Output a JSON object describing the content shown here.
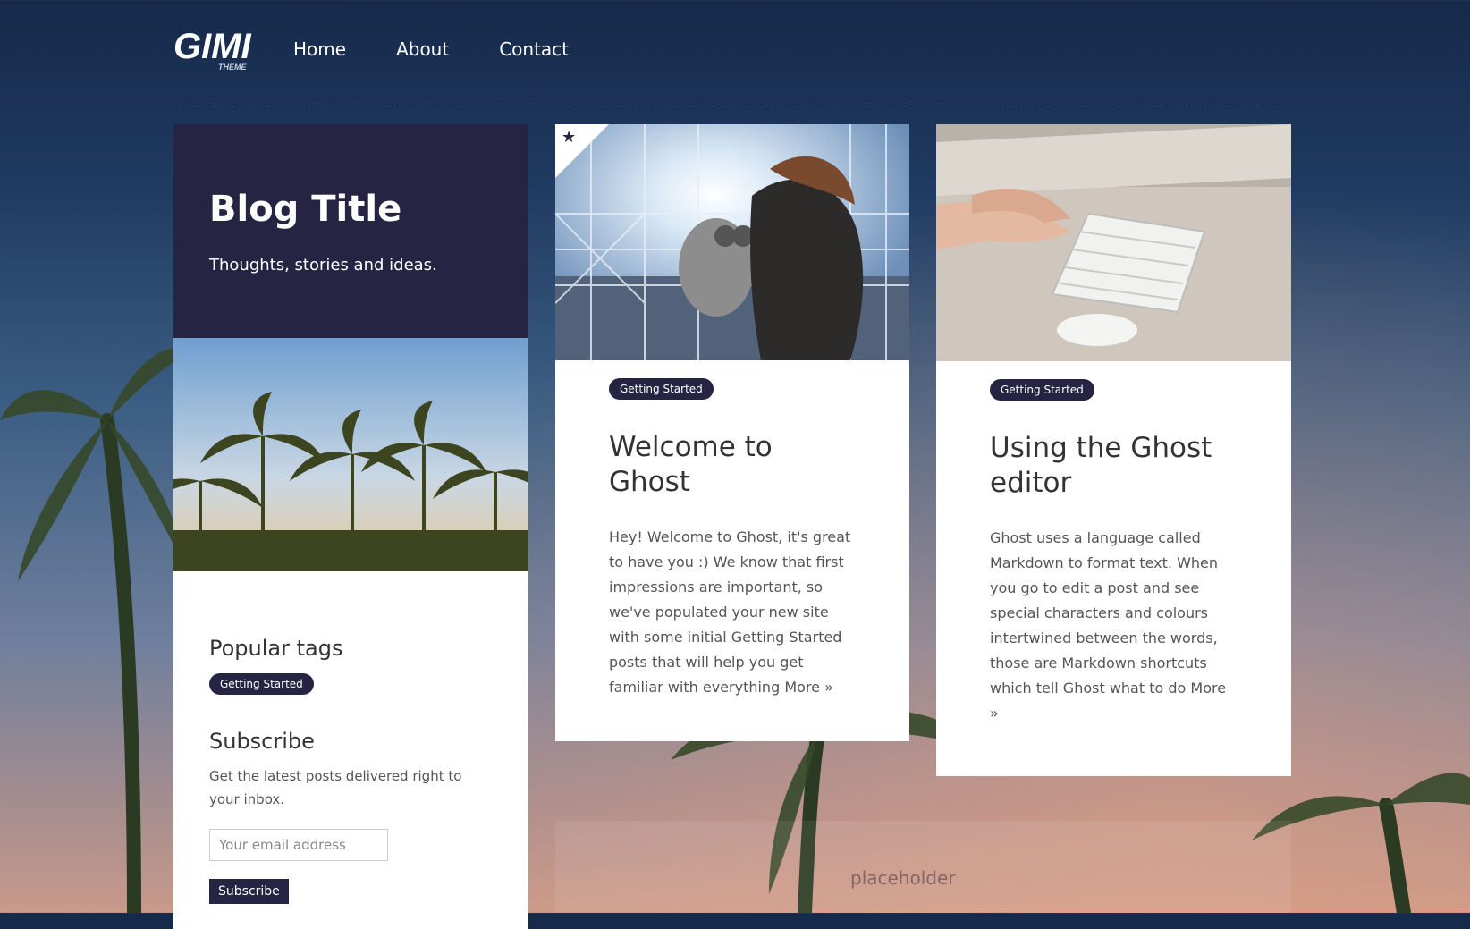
{
  "header": {
    "logo": "GIMI",
    "logo_sub": "THEME",
    "nav": [
      {
        "label": "Home"
      },
      {
        "label": "About"
      },
      {
        "label": "Contact"
      }
    ]
  },
  "sidebar": {
    "blog_title": "Blog Title",
    "blog_description": "Thoughts, stories and ideas.",
    "popular_tags_heading": "Popular tags",
    "tags": [
      "Getting Started"
    ],
    "subscribe_heading": "Subscribe",
    "subscribe_text": "Get the latest posts delivered right to your inbox.",
    "email_placeholder": "Your email address",
    "subscribe_button": "Subscribe"
  },
  "posts": [
    {
      "tag": "Getting Started",
      "title": "Welcome to Ghost",
      "excerpt": "Hey! Welcome to Ghost, it's great to have you :) We know that first impressions are important, so we've populated your new site with some initial Getting Started posts that will help you get familiar with everything",
      "more": "More »",
      "featured": true
    },
    {
      "tag": "Getting Started",
      "title": "Using the Ghost editor",
      "excerpt": "Ghost uses a language called Markdown to format text. When you go to edit a post and see special characters and colours intertwined between the words, those are Markdown shortcuts which tell Ghost what to do",
      "more": "More »",
      "featured": false
    }
  ],
  "placeholder": {
    "text": "placeholder"
  },
  "colors": {
    "accent": "#252543",
    "card": "#ffffff"
  }
}
